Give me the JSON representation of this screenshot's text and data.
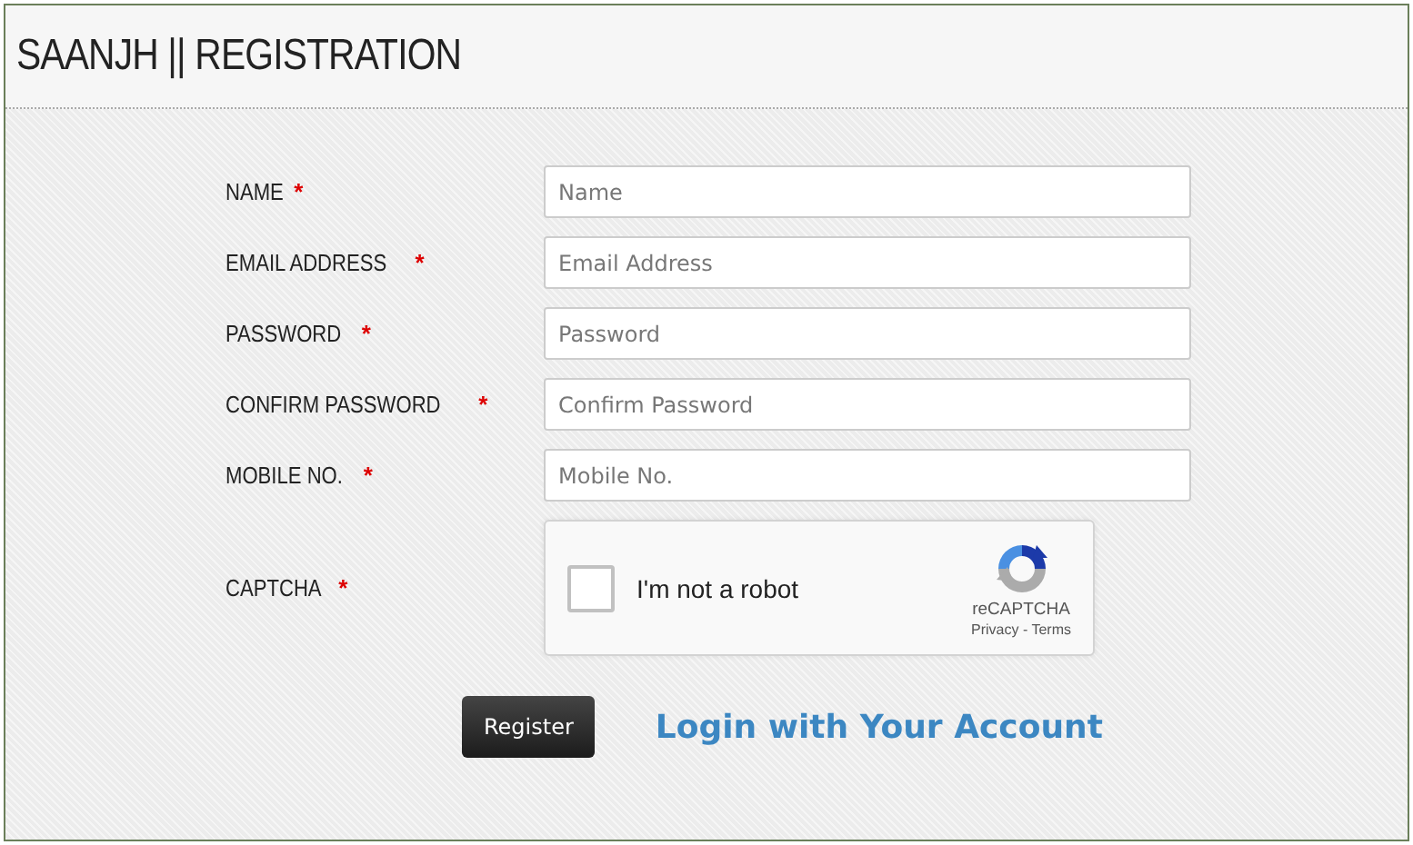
{
  "header": {
    "title": "SAANJH || REGISTRATION"
  },
  "fields": [
    {
      "label": "NAME",
      "required_mark": "*",
      "placeholder": "Name"
    },
    {
      "label": "EMAIL ADDRESS",
      "required_mark": "*",
      "placeholder": "Email Address"
    },
    {
      "label": "PASSWORD",
      "required_mark": "*",
      "placeholder": "Password"
    },
    {
      "label": "CONFIRM PASSWORD",
      "required_mark": "*",
      "placeholder": "Confirm Password"
    },
    {
      "label": "MOBILE NO.",
      "required_mark": "*",
      "placeholder": "Mobile No."
    }
  ],
  "captcha": {
    "label": "CAPTCHA",
    "required_mark": "*",
    "checkbox_label": "I'm not a robot",
    "checked": false,
    "brand": "reCAPTCHA",
    "links": "Privacy - Terms"
  },
  "register_button": "Register",
  "login_link": "Login with Your Account"
}
